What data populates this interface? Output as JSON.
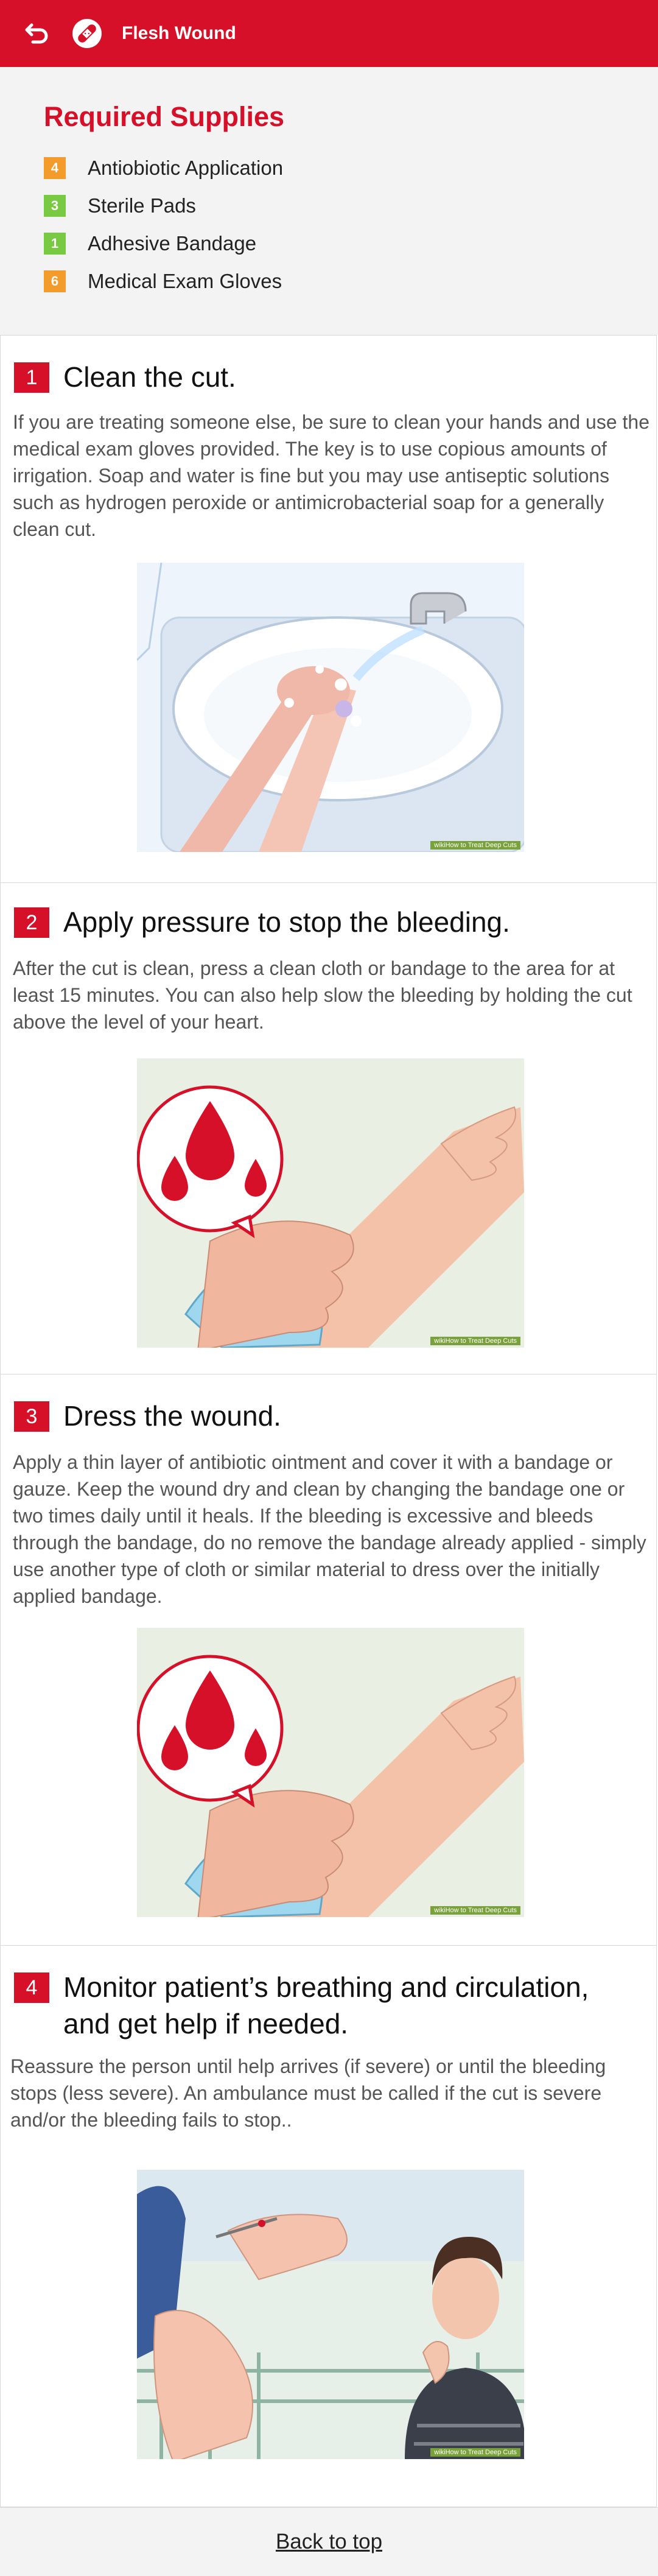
{
  "header": {
    "title": "Flesh Wound",
    "back_icon": "back-arrow-icon",
    "bandage_icon": "bandage-icon",
    "color": "#d7102a"
  },
  "supplies": {
    "heading": "Required Supplies",
    "items": [
      {
        "qty": "4",
        "name": "Antiobiotic Application",
        "color": "#f39c2b"
      },
      {
        "qty": "3",
        "name": "Sterile Pads",
        "color": "#7ac943"
      },
      {
        "qty": "1",
        "name": "Adhesive Bandage",
        "color": "#7ac943"
      },
      {
        "qty": "6",
        "name": "Medical Exam Gloves",
        "color": "#f39c2b"
      }
    ]
  },
  "steps": [
    {
      "number": "1",
      "title": "Clean the cut.",
      "text": "If you are treating someone else, be sure to clean your hands and use the medical exam gloves provided. The key is to use copious amounts of irrigation. Soap and water is fine but you may use antiseptic solutions such as hydrogen peroxide or antimicrobacterial soap for a generally clean cut.",
      "watermark": "wikiHow to Treat Deep Cuts"
    },
    {
      "number": "2",
      "title": "Apply pressure to stop the bleeding.",
      "text": "After the cut is clean, press a clean cloth or bandage to the area for at least 15 minutes. You can also help slow the bleeding by holding the cut above the level of your heart.",
      "watermark": "wikiHow to Treat Deep Cuts"
    },
    {
      "number": "3",
      "title": "Dress the wound.",
      "text": "Apply a thin layer of antibiotic ointment and cover it with a bandage or gauze. Keep the wound dry and clean by changing the bandage one or two times daily until it heals. If the bleeding is excessive and bleeds through the bandage, do no remove the bandage already applied - simply use another type of cloth or similar material to dress over the initially applied bandage.",
      "watermark": "wikiHow to Treat Deep Cuts"
    },
    {
      "number": "4",
      "title": "Monitor patient’s breathing and circulation, and get help if needed.",
      "text": "Reassure the person until help arrives (if severe) or until the bleeding stops (less severe). An ambulance must be called if the cut is severe and/or the bleeding fails to stop..",
      "watermark": "wikiHow to Treat Deep Cuts"
    }
  ],
  "footer": {
    "link": "Back to top"
  }
}
